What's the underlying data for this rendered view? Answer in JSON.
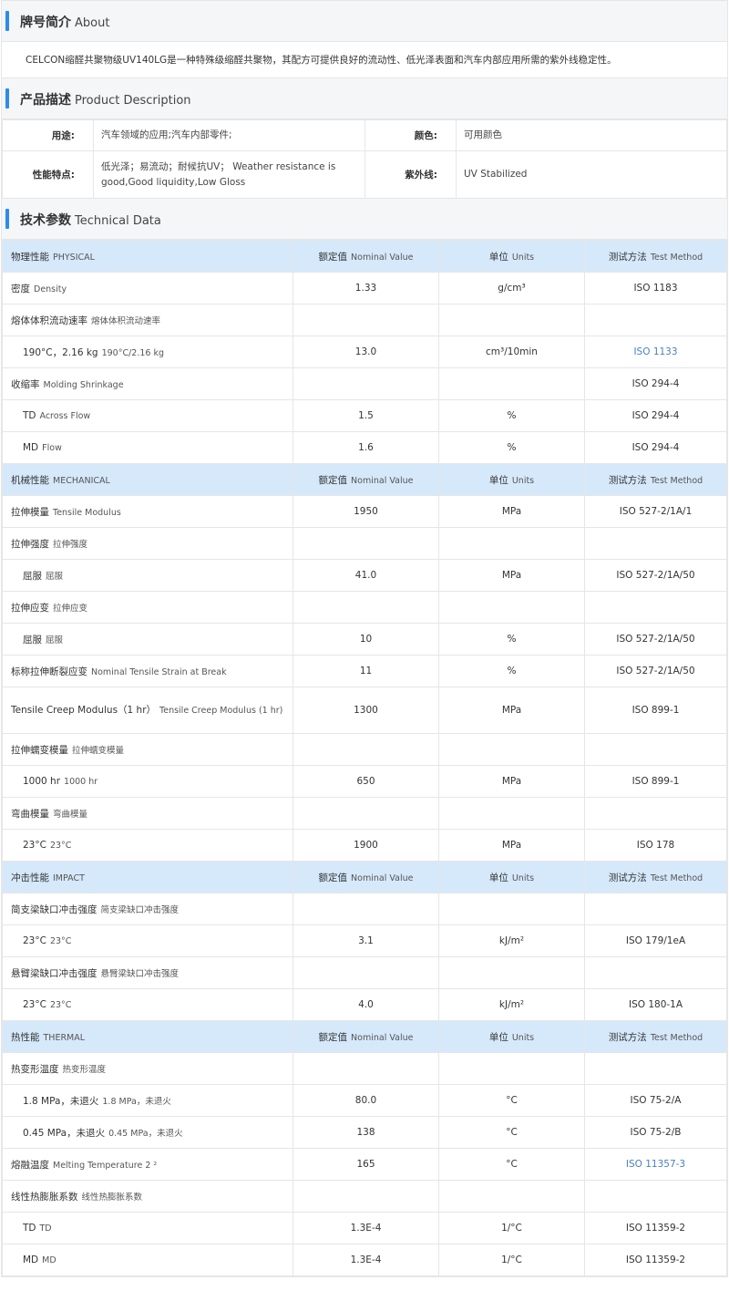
{
  "about": {
    "title_cn": "牌号简介",
    "title_en": "About",
    "text": "CELCON缩醛共聚物级UV140LG是一种特殊级缩醛共聚物，其配方可提供良好的流动性、低光泽表面和汽车内部应用所需的紫外线稳定性。"
  },
  "product": {
    "title_cn": "产品描述",
    "title_en": "Product Description",
    "rows": [
      {
        "l1": "用途:",
        "v1": "汽车领域的应用;汽车内部零件;",
        "l2": "颜色:",
        "v2": "可用颜色"
      },
      {
        "l1": "性能特点:",
        "v1": "低光泽；易流动；耐候抗UV； Weather resistance is good,Good liquidity,Low Gloss",
        "l2": "紫外线:",
        "v2": "UV Stabilized"
      }
    ]
  },
  "tech": {
    "title_cn": "技术参数",
    "title_en": "Technical Data",
    "header": {
      "nominal_cn": "额定值",
      "nominal_en": "Nominal Value",
      "units_cn": "单位",
      "units_en": "Units",
      "method_cn": "测试方法",
      "method_en": "Test Method"
    },
    "sections": [
      {
        "cn": "物理性能",
        "en": "PHYSICAL",
        "rows": [
          {
            "cn": "密度",
            "en": "Density",
            "value": "1.33",
            "unit": "g/cm³",
            "method": "ISO 1183",
            "sub": false
          },
          {
            "cn": "熔体体积流动速率",
            "en": "熔体体积流动速率",
            "value": "",
            "unit": "",
            "method": "",
            "sub": false
          },
          {
            "cn": "190°C，2.16 kg",
            "en": "190°C/2.16 kg",
            "value": "13.0",
            "unit": "cm³/10min",
            "method": "ISO 1133",
            "sub": true,
            "link": true
          },
          {
            "cn": "收缩率",
            "en": "Molding Shrinkage",
            "value": "",
            "unit": "",
            "method": "ISO 294-4",
            "sub": false
          },
          {
            "cn": "TD",
            "en": "Across Flow",
            "value": "1.5",
            "unit": "%",
            "method": "ISO 294-4",
            "sub": true
          },
          {
            "cn": "MD",
            "en": "Flow",
            "value": "1.6",
            "unit": "%",
            "method": "ISO 294-4",
            "sub": true
          }
        ]
      },
      {
        "cn": "机械性能",
        "en": "MECHANICAL",
        "rows": [
          {
            "cn": "拉伸模量",
            "en": "Tensile Modulus",
            "value": "1950",
            "unit": "MPa",
            "method": "ISO 527-2/1A/1",
            "sub": false
          },
          {
            "cn": "拉伸强度",
            "en": "拉伸强度",
            "value": "",
            "unit": "",
            "method": "",
            "sub": false
          },
          {
            "cn": "屈服",
            "en": "屈服",
            "value": "41.0",
            "unit": "MPa",
            "method": "ISO 527-2/1A/50",
            "sub": true
          },
          {
            "cn": "拉伸应变",
            "en": "拉伸应变",
            "value": "",
            "unit": "",
            "method": "",
            "sub": false
          },
          {
            "cn": "屈服",
            "en": "屈服",
            "value": "10",
            "unit": "%",
            "method": "ISO 527-2/1A/50",
            "sub": true
          },
          {
            "cn": "标称拉伸断裂应变",
            "en": "Nominal Tensile Strain at Break",
            "value": "11",
            "unit": "%",
            "method": "ISO 527-2/1A/50",
            "sub": false
          },
          {
            "cn": "Tensile Creep Modulus（1 hr）",
            "en": "Tensile Creep Modulus (1 hr)",
            "value": "1300",
            "unit": "MPa",
            "method": "ISO 899-1",
            "sub": false,
            "tall": true
          },
          {
            "cn": "拉伸蠕变模量",
            "en": "拉伸蠕变模量",
            "value": "",
            "unit": "",
            "method": "",
            "sub": false
          },
          {
            "cn": "1000 hr",
            "en": "1000 hr",
            "value": "650",
            "unit": "MPa",
            "method": "ISO 899-1",
            "sub": true
          },
          {
            "cn": "弯曲模量",
            "en": "弯曲模量",
            "value": "",
            "unit": "",
            "method": "",
            "sub": false
          },
          {
            "cn": "23°C",
            "en": "23°C",
            "value": "1900",
            "unit": "MPa",
            "method": "ISO 178",
            "sub": true
          }
        ]
      },
      {
        "cn": "冲击性能",
        "en": "IMPACT",
        "rows": [
          {
            "cn": "简支梁缺口冲击强度",
            "en": "简支梁缺口冲击强度",
            "value": "",
            "unit": "",
            "method": "",
            "sub": false
          },
          {
            "cn": "23°C",
            "en": "23°C",
            "value": "3.1",
            "unit": "kJ/m²",
            "method": "ISO 179/1eA",
            "sub": true
          },
          {
            "cn": "悬臂梁缺口冲击强度",
            "en": "悬臂梁缺口冲击强度",
            "value": "",
            "unit": "",
            "method": "",
            "sub": false
          },
          {
            "cn": "23°C",
            "en": "23°C",
            "value": "4.0",
            "unit": "kJ/m²",
            "method": "ISO 180-1A",
            "sub": true
          }
        ]
      },
      {
        "cn": "热性能",
        "en": "THERMAL",
        "rows": [
          {
            "cn": "热变形温度",
            "en": "热变形温度",
            "value": "",
            "unit": "",
            "method": "",
            "sub": false
          },
          {
            "cn": "1.8 MPa，未退火",
            "en": "1.8 MPa，未退火",
            "value": "80.0",
            "unit": "°C",
            "method": "ISO 75-2/A",
            "sub": true
          },
          {
            "cn": "0.45 MPa，未退火",
            "en": "0.45 MPa，未退火",
            "value": "138",
            "unit": "°C",
            "method": "ISO 75-2/B",
            "sub": true
          },
          {
            "cn": "熔融温度",
            "en": "Melting Temperature  2 ²",
            "value": "165",
            "unit": "°C",
            "method": "ISO 11357-3",
            "sub": false,
            "link": true
          },
          {
            "cn": "线性热膨胀系数",
            "en": "线性热膨胀系数",
            "value": "",
            "unit": "",
            "method": "",
            "sub": false
          },
          {
            "cn": "TD",
            "en": "TD",
            "value": "1.3E-4",
            "unit": "1/°C",
            "method": "ISO 11359-2",
            "sub": true
          },
          {
            "cn": "MD",
            "en": "MD",
            "value": "1.3E-4",
            "unit": "1/°C",
            "method": "ISO 11359-2",
            "sub": true
          }
        ]
      }
    ]
  },
  "colors": {
    "accent": "#2d8ce6",
    "header_bg": "#d6e9fb",
    "link": "#4a7fc0"
  }
}
